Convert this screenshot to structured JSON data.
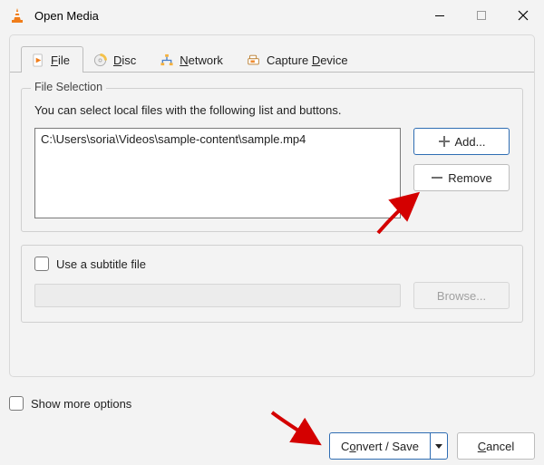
{
  "window": {
    "title": "Open Media"
  },
  "tabs": {
    "file": {
      "prefix": "",
      "ul": "F",
      "suffix": "ile"
    },
    "disc": {
      "prefix": "",
      "ul": "D",
      "suffix": "isc"
    },
    "network": {
      "prefix": "",
      "ul": "N",
      "suffix": "etwork"
    },
    "capture": {
      "prefix": "Capture ",
      "ul": "D",
      "suffix": "evice"
    }
  },
  "file_selection": {
    "group_title": "File Selection",
    "hint": "You can select local files with the following list and buttons.",
    "files": [
      "C:\\Users\\soria\\Videos\\sample-content\\sample.mp4"
    ],
    "add_label": "Add...",
    "remove_label": "Remove"
  },
  "subtitle": {
    "checkbox_label": "Use a subtitle file",
    "browse_label": "Browse..."
  },
  "more_options": {
    "prefix": "Show ",
    "ul": "m",
    "suffix": "ore options"
  },
  "actions": {
    "convert": {
      "prefix": "C",
      "ul": "o",
      "suffix": "nvert / Save"
    },
    "cancel": {
      "prefix": "",
      "ul": "C",
      "suffix": "ancel"
    }
  }
}
